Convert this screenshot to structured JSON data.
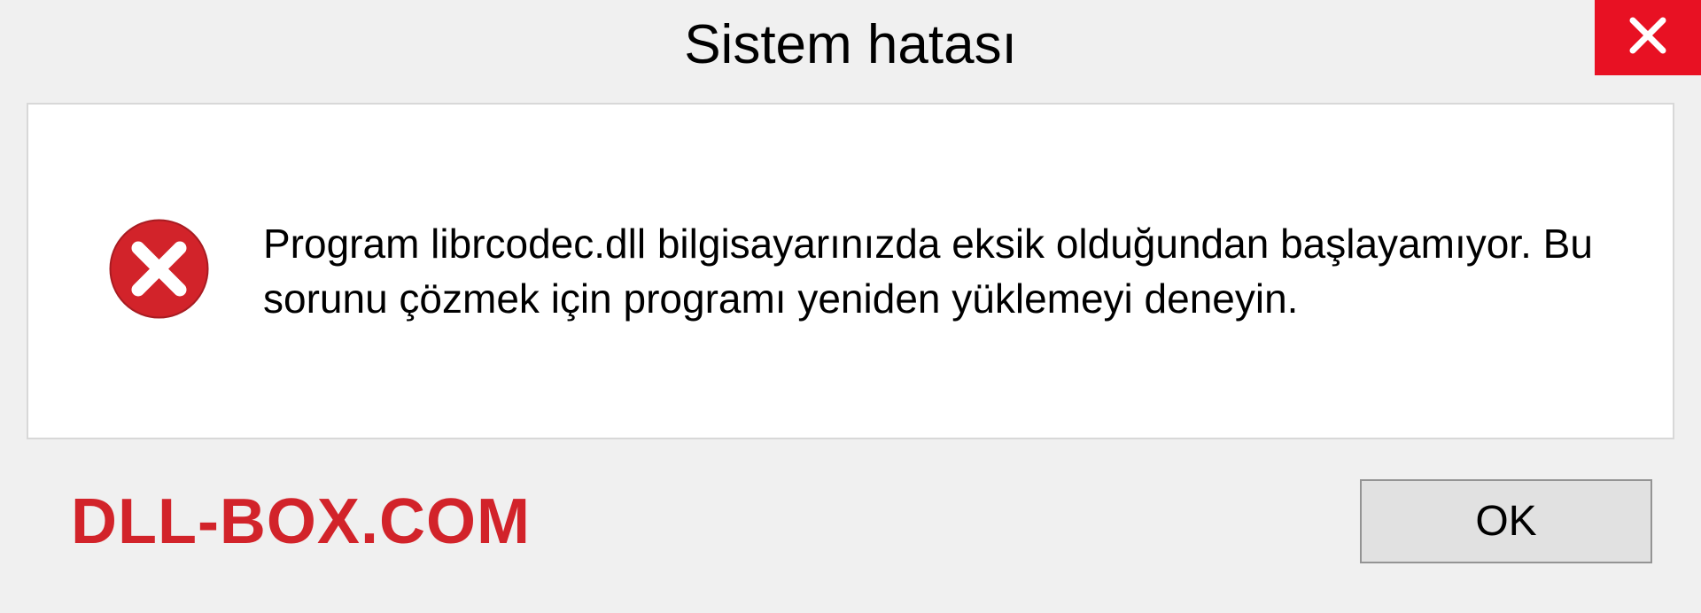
{
  "dialog": {
    "title": "Sistem hatası",
    "message": "Program librcodec.dll bilgisayarınızda eksik olduğundan başlayamıyor. Bu sorunu çözmek için programı yeniden yüklemeyi deneyin.",
    "ok_label": "OK",
    "watermark": "DLL-BOX.COM"
  },
  "colors": {
    "close_bg": "#e81123",
    "error_icon": "#d2232a",
    "watermark": "#d2232a"
  }
}
